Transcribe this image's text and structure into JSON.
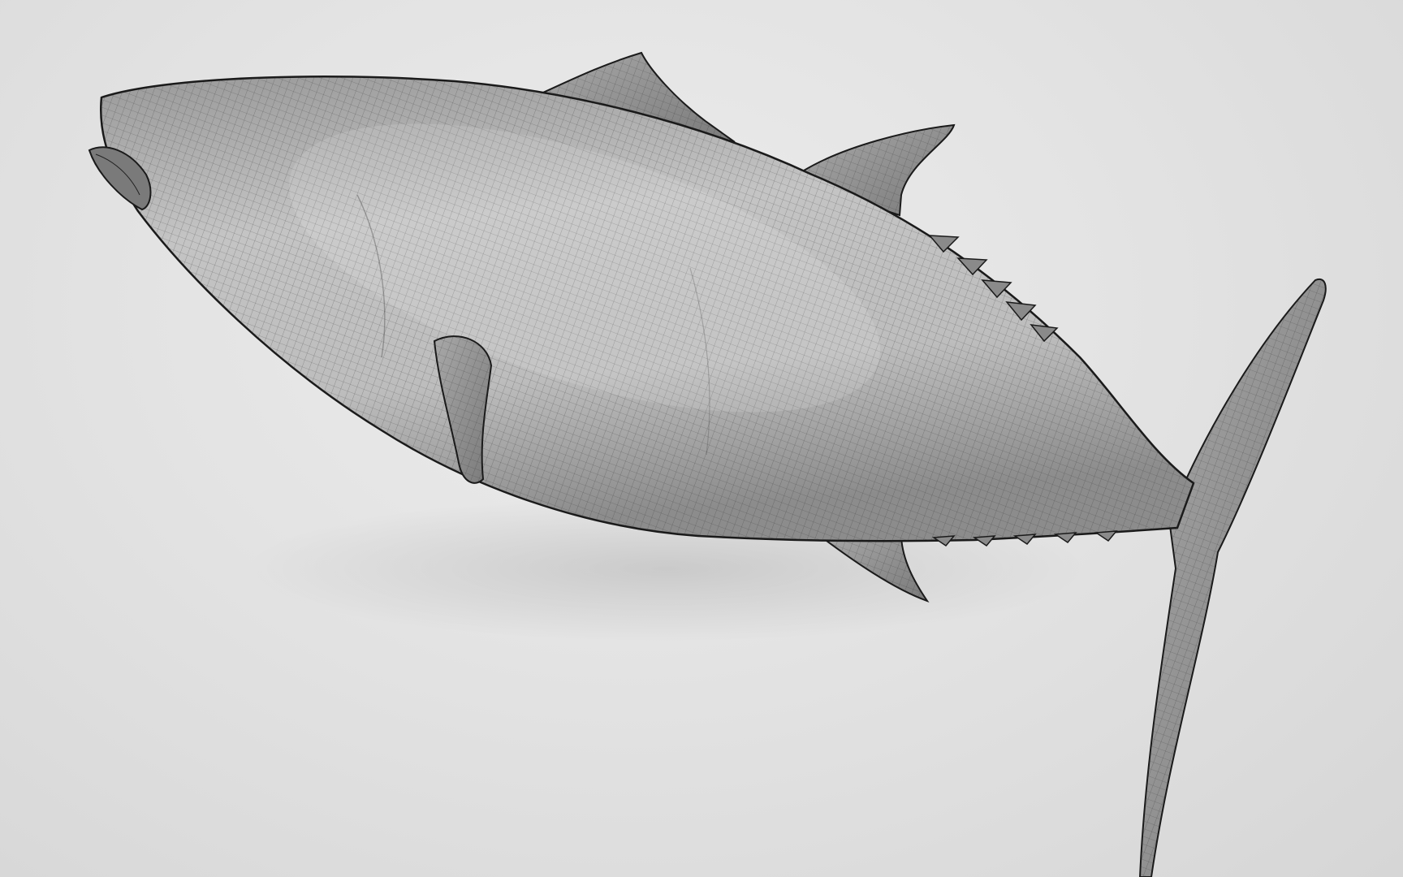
{
  "scene": {
    "subject": "tuna-wireframe-mesh",
    "background_color": "#e4e4e4",
    "mesh_fill_color": "#b8b8b8",
    "mesh_line_color": "#2a2a2a",
    "outline_color": "#1a1a1a"
  }
}
